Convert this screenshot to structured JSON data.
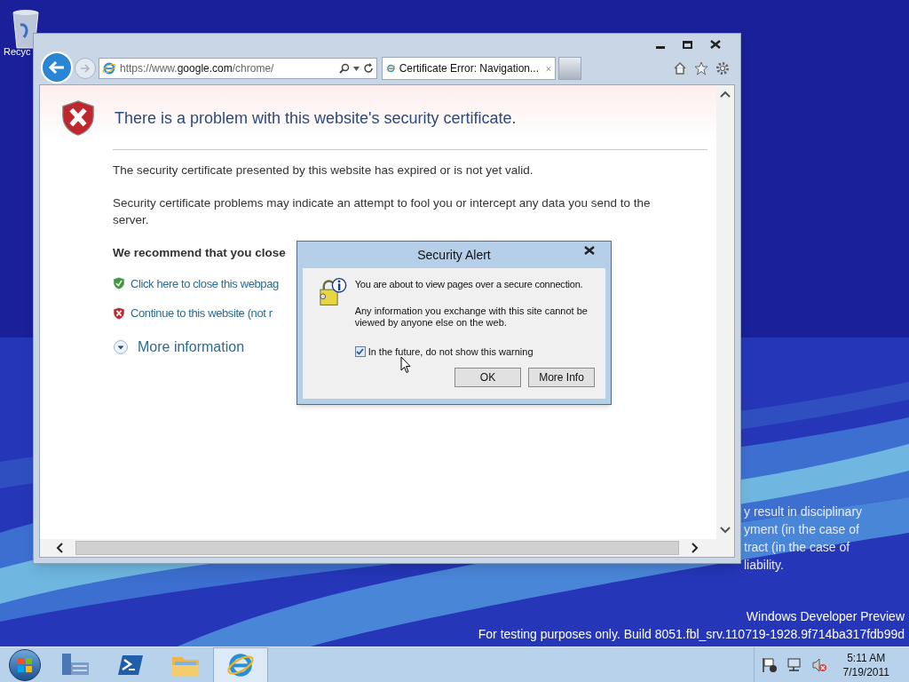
{
  "desktop": {
    "icons": [
      {
        "label": "Recyc"
      }
    ],
    "notice_lines": [
      "y result in disciplinary",
      "yment (in the case of",
      "tract (in the case of",
      "liability."
    ],
    "watermark": [
      "Windows Developer Preview",
      "For testing purposes only. Build 8051.fbl_srv.110719-1928.9f714ba317fdb99d"
    ]
  },
  "browser": {
    "address": {
      "prefix": "https://www.",
      "domain": "google.com",
      "path": "/chrome/"
    },
    "tabs": [
      {
        "label": "Certificate Error: Navigation...",
        "selected": true
      }
    ],
    "page": {
      "heading": "There is a problem with this website's security certificate.",
      "paragraphs": [
        "The security certificate presented by this website has expired or is not yet valid.",
        "Security certificate problems may indicate an attempt to fool you or intercept any data you send to the server."
      ],
      "recommend": "We recommend that you close",
      "links": [
        {
          "kind": "safe",
          "label": "Click here to close this webpag"
        },
        {
          "kind": "unsafe",
          "label": "Continue to this website (not r"
        }
      ],
      "more": "More information"
    }
  },
  "dialog": {
    "title": "Security Alert",
    "message": "You are about to view pages over a secure connection.",
    "detail": "Any information you exchange with this site cannot be viewed by anyone else on the web.",
    "checkbox": {
      "label": "In the future, do not show this warning",
      "checked": true
    },
    "buttons": [
      "OK",
      "More Info"
    ]
  },
  "taskbar": {
    "apps": [
      {
        "kind": "server",
        "selected": false
      },
      {
        "kind": "shell",
        "selected": false
      },
      {
        "kind": "folder",
        "selected": false
      },
      {
        "kind": "ie",
        "selected": true
      }
    ],
    "time": "5:11 AM",
    "date": "7/19/2011"
  }
}
